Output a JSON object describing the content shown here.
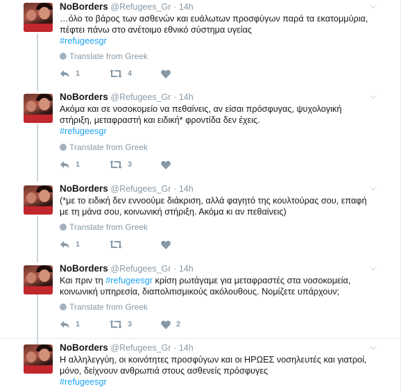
{
  "tweets": [
    {
      "name": "NoBorders",
      "handle": "@Refugees_Gr",
      "sep": "·",
      "time": "14h",
      "line1": "…όλο το βάρος των ασθενών και ευάλωτων προσφύγων παρά τα εκατομμύρια,",
      "line2": "πέφτει πάνω στο ανέτοιμο εθνικό σύστημα υγείας",
      "hashtag": "#refugeesgr",
      "translate": "Translate from Greek",
      "replies": "1",
      "retweets": "4",
      "likes": ""
    },
    {
      "name": "NoBorders",
      "handle": "@Refugees_Gr",
      "sep": "·",
      "time": "14h",
      "line1": "Ακόμα και σε νοσοκομείο να πεθαίνεις, αν είσαι πρόσφυγας, ψυχολογική",
      "line2": "στήριξη, μεταφραστή και ειδική* φροντίδα δεν έχεις.",
      "hashtag": "#refugeesgr",
      "translate": "Translate from Greek",
      "replies": "1",
      "retweets": "3",
      "likes": ""
    },
    {
      "name": "NoBorders",
      "handle": "@Refugees_Gr",
      "sep": "·",
      "time": "14h",
      "line1": "(*με το ειδική δεν εννοούμε διάκριση,  αλλά φαγητό της κουλτούρας σου, επαφή",
      "line2": "με τη μάνα σου, κοινωνική στήριξη. Ακόμα κι αν πεθαίνεις)",
      "translate": "Translate from Greek",
      "replies": "1",
      "retweets": "",
      "likes": ""
    },
    {
      "name": "NoBorders",
      "handle": "@Refugees_Gr",
      "sep": "·",
      "time": "14h",
      "line1_pre": "Και πριν τη ",
      "line1_tag": "#refugeesgr",
      "line1_post": " κρίση ρωτάγαμε για μεταφραστές στα νοσοκομεία,",
      "line2": "κοινωνική υπηρεσία, διαπολιτισμικούς ακόλουθους. Νομίζετε υπάρχουν;",
      "translate": "Translate from Greek",
      "replies": "1",
      "retweets": "3",
      "likes": "2"
    },
    {
      "name": "NoBorders",
      "handle": "@Refugees_Gr",
      "sep": "·",
      "time": "14h",
      "line1": "Η αλληλεγγύη, οι κοινότητες προσφύγων και οι ΗΡΩΕΣ νοσηλευτές και γιατροί,",
      "line2": "μόνο, δείχνουν ανθρωπιά στους ασθενείς πρόσφυγες",
      "hashtag": "#refugeesgr"
    }
  ],
  "colors": {
    "link": "#1da1f2",
    "muted": "#8899a6",
    "thread": "#ccd6dd"
  },
  "icons": [
    "reply-icon",
    "retweet-icon",
    "like-icon",
    "chevron-down-icon",
    "globe-icon"
  ]
}
